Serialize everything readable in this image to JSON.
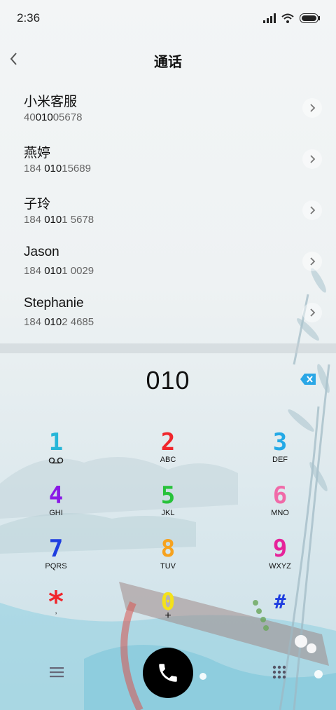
{
  "status_bar": {
    "time": "2:36"
  },
  "header": {
    "title": "通话"
  },
  "contacts": [
    {
      "name": "小米客服",
      "number_pre": "40",
      "number_match": "010",
      "number_post": "05678"
    },
    {
      "name": "燕婷",
      "number_pre": "184 ",
      "number_match": "010",
      "number_post": "15689"
    },
    {
      "name": "子玲",
      "number_pre": "184 ",
      "number_match": "010",
      "number_post": "1 5678"
    },
    {
      "name": "Jason",
      "number_pre": "184 ",
      "number_match": "010",
      "number_post": "1 0029"
    },
    {
      "name": "Stephanie",
      "number_pre": "184 ",
      "number_match": "010",
      "number_post": "2 4685"
    }
  ],
  "dialer": {
    "entered_number": "010"
  },
  "keypad": [
    {
      "digit": "1",
      "letters": "",
      "color": "#27b6d8"
    },
    {
      "digit": "2",
      "letters": "ABC",
      "color": "#f0262c"
    },
    {
      "digit": "3",
      "letters": "DEF",
      "color": "#23a9e6"
    },
    {
      "digit": "4",
      "letters": "GHI",
      "color": "#8a19e6"
    },
    {
      "digit": "5",
      "letters": "JKL",
      "color": "#27c23a"
    },
    {
      "digit": "6",
      "letters": "MNO",
      "color": "#f06aa8"
    },
    {
      "digit": "7",
      "letters": "PQRS",
      "color": "#1f3ee0"
    },
    {
      "digit": "8",
      "letters": "TUV",
      "color": "#f6a21e"
    },
    {
      "digit": "9",
      "letters": "WXYZ",
      "color": "#e6239a"
    },
    {
      "digit": "*",
      "letters": ",",
      "color": "#f0262c"
    },
    {
      "digit": "0",
      "letters": "+",
      "color": "#f4e21a"
    },
    {
      "digit": "#",
      "letters": "",
      "color": "#1f3ee0"
    }
  ],
  "icons": {
    "back": "chevron-left-icon",
    "chevron": "chevron-right-icon",
    "delete": "backspace-icon",
    "call": "phone-icon",
    "menu": "menu-icon",
    "dialpad": "dialpad-icon",
    "voicemail": "voicemail-icon"
  }
}
